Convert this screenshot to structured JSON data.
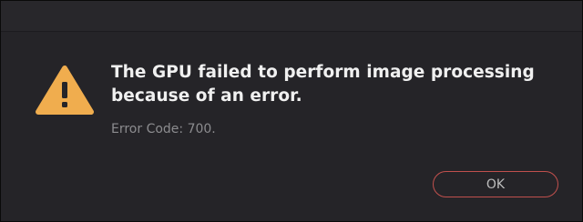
{
  "dialog": {
    "icon": "warning-icon",
    "title_line1": "The GPU failed to perform image processing",
    "title_line2": "because of an error.",
    "error_code": "Error Code: 700.",
    "ok_label": "OK"
  },
  "colors": {
    "background": "#252428",
    "title_text": "#f0f0f0",
    "secondary_text": "#8c8c8f",
    "button_border": "#c0504d",
    "warning_fill": "#f0ad4e"
  }
}
